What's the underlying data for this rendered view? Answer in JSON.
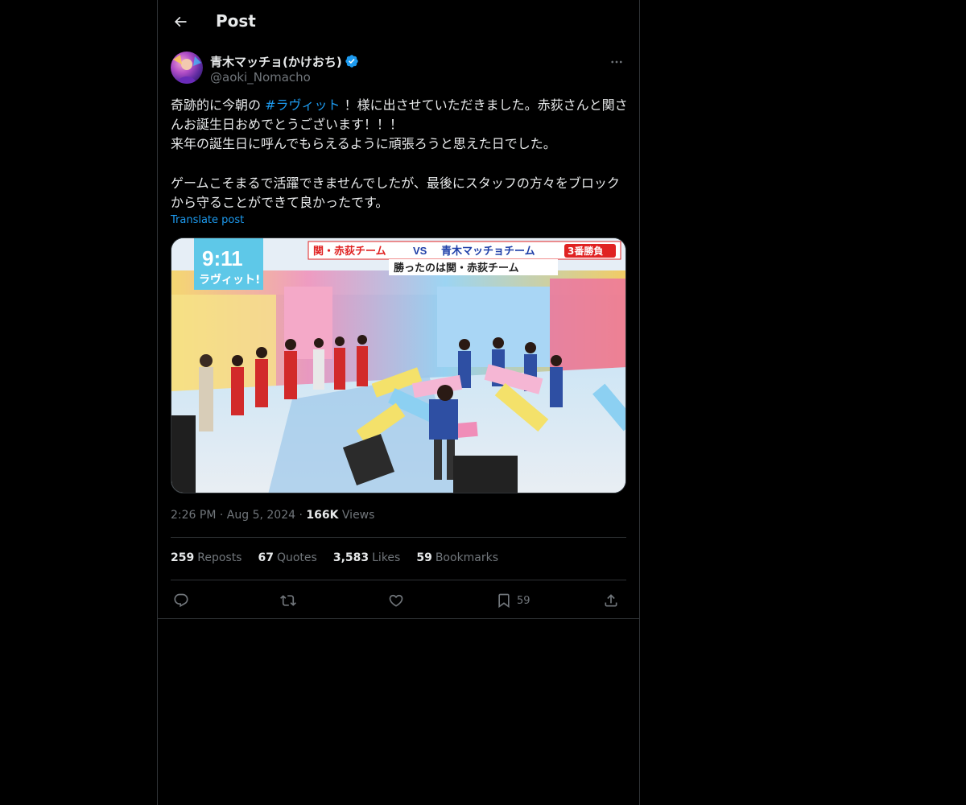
{
  "header": {
    "title": "Post"
  },
  "author": {
    "name": "青木マッチョ(かけおち)",
    "handle": "@aoki_Nomacho"
  },
  "tweet": {
    "text_before": "奇跡的に今朝の ",
    "hashtag": "#ラヴィット",
    "text_after": " ！様に出させていただきました。赤荻さんと関さんお誕生日おめでとうございます！！！\n来年の誕生日に呼んでもらえるように頑張ろうと思えた日でした。\n\nゲームこそまるで活躍できませんでしたが、最後にスタッフの方々をブロックから守ることができて良かったです。",
    "translate_label": "Translate post"
  },
  "media": {
    "clock": "9:11",
    "show_logo": "ラヴィット!",
    "banner_line1_team_a": "関・赤荻チーム",
    "banner_vs": "VS",
    "banner_line1_team_b": "青木マッチョチーム",
    "banner_game": "3番勝負",
    "banner_line2": "勝ったのは関・赤荻チーム"
  },
  "meta": {
    "time": "2:26 PM",
    "date": "Aug 5, 2024",
    "views_count": "166K",
    "views_label": "Views"
  },
  "stats": {
    "reposts_count": "259",
    "reposts_label": "Reposts",
    "quotes_count": "67",
    "quotes_label": "Quotes",
    "likes_count": "3,583",
    "likes_label": "Likes",
    "bookmarks_count": "59",
    "bookmarks_label": "Bookmarks"
  },
  "actions": {
    "bookmark_count": "59"
  },
  "colors": {
    "background": "#000000",
    "accent": "#1d9bf0",
    "text": "#e7e9ea",
    "muted": "#71767b",
    "border": "#2f3336"
  }
}
